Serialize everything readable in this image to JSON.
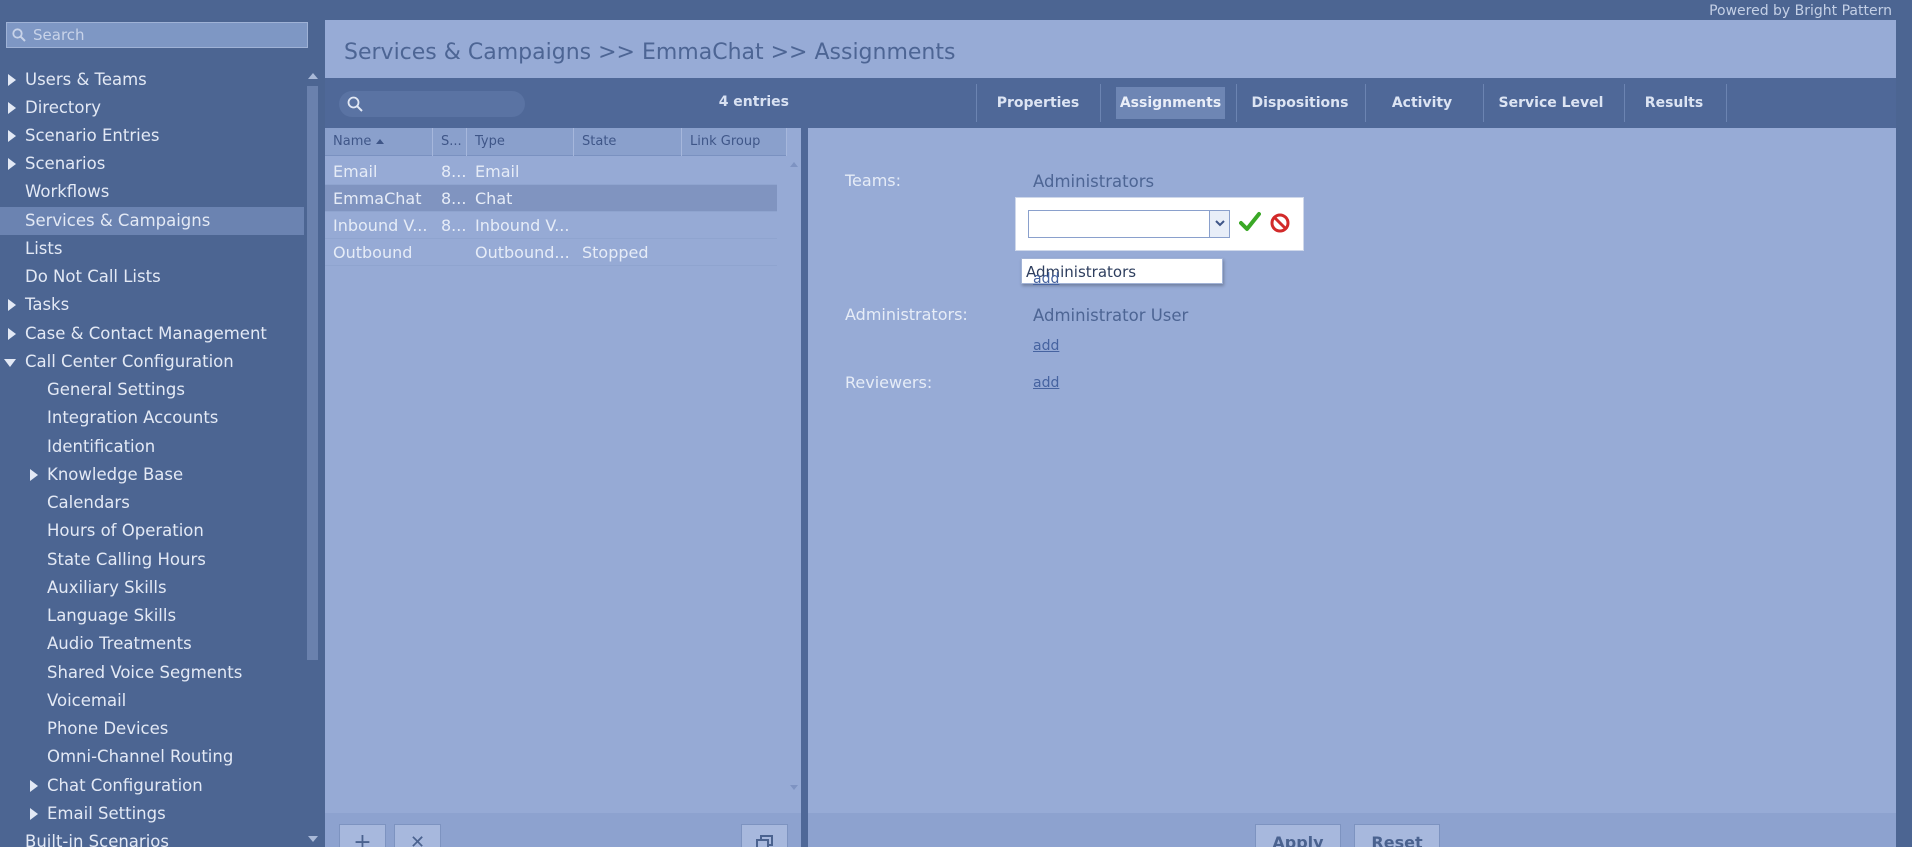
{
  "header": {
    "powered_by": "Powered by Bright Pattern"
  },
  "sidebar": {
    "search_placeholder": "Search",
    "items": [
      {
        "label": "Users & Teams",
        "arrow": "right"
      },
      {
        "label": "Directory",
        "arrow": "right"
      },
      {
        "label": "Scenario Entries",
        "arrow": "right"
      },
      {
        "label": "Scenarios",
        "arrow": "right"
      },
      {
        "label": "Workflows"
      },
      {
        "label": "Services & Campaigns",
        "active": true
      },
      {
        "label": "Lists"
      },
      {
        "label": "Do Not Call Lists"
      },
      {
        "label": "Tasks",
        "arrow": "right"
      },
      {
        "label": "Case & Contact Management",
        "arrow": "right"
      },
      {
        "label": "Call Center Configuration",
        "arrow": "down"
      },
      {
        "label": "General Settings",
        "child": true
      },
      {
        "label": "Integration Accounts",
        "child": true
      },
      {
        "label": "Identification",
        "child": true
      },
      {
        "label": "Knowledge Base",
        "child": true,
        "arrow": "right"
      },
      {
        "label": "Calendars",
        "child": true
      },
      {
        "label": "Hours of Operation",
        "child": true
      },
      {
        "label": "State Calling Hours",
        "child": true
      },
      {
        "label": "Auxiliary Skills",
        "child": true
      },
      {
        "label": "Language Skills",
        "child": true
      },
      {
        "label": "Audio Treatments",
        "child": true
      },
      {
        "label": "Shared Voice Segments",
        "child": true
      },
      {
        "label": "Voicemail",
        "child": true
      },
      {
        "label": "Phone Devices",
        "child": true
      },
      {
        "label": "Omni-Channel Routing",
        "child": true
      },
      {
        "label": "Chat Configuration",
        "child": true,
        "arrow": "right"
      },
      {
        "label": "Email Settings",
        "child": true,
        "arrow": "right"
      },
      {
        "label": "Built-in Scenarios"
      }
    ]
  },
  "page": {
    "breadcrumb": "Services & Campaigns >> EmmaChat >> Assignments"
  },
  "list": {
    "entries": "4 entries",
    "columns": [
      "Name",
      "S...",
      "Type",
      "State",
      "Link Group"
    ],
    "rows": [
      {
        "name": "Email",
        "s": "8...",
        "type": "Email",
        "state": "",
        "link_group": ""
      },
      {
        "name": "EmmaChat",
        "s": "8...",
        "type": "Chat",
        "state": "",
        "link_group": "",
        "selected": true
      },
      {
        "name": "Inbound V...",
        "s": "8...",
        "type": "Inbound V...",
        "state": "",
        "link_group": ""
      },
      {
        "name": "Outbound",
        "s": "",
        "type": "Outbound...",
        "state": "Stopped",
        "link_group": ""
      }
    ],
    "footer": {
      "add": "+",
      "delete": "✕"
    }
  },
  "tabs": [
    {
      "label": "Properties"
    },
    {
      "label": "Assignments",
      "active": true
    },
    {
      "label": "Dispositions"
    },
    {
      "label": "Activity"
    },
    {
      "label": "Service Level"
    },
    {
      "label": "Results"
    }
  ],
  "assignments": {
    "teams_label": "Teams:",
    "teams_value": "Administrators",
    "combo_value": "",
    "dropdown_option": "Administrators",
    "add": "add",
    "administrators_label": "Administrators:",
    "administrators_value": "Administrator User",
    "reviewers_label": "Reviewers:"
  },
  "buttons": {
    "apply": "Apply",
    "reset": "Reset"
  },
  "colors": {
    "sidebar_bg": "#4c6592",
    "main_bg": "#97abd6",
    "toolbar_bg": "#4f6898",
    "ok_green": "#3aa826",
    "cancel_red": "#d22a2a"
  }
}
